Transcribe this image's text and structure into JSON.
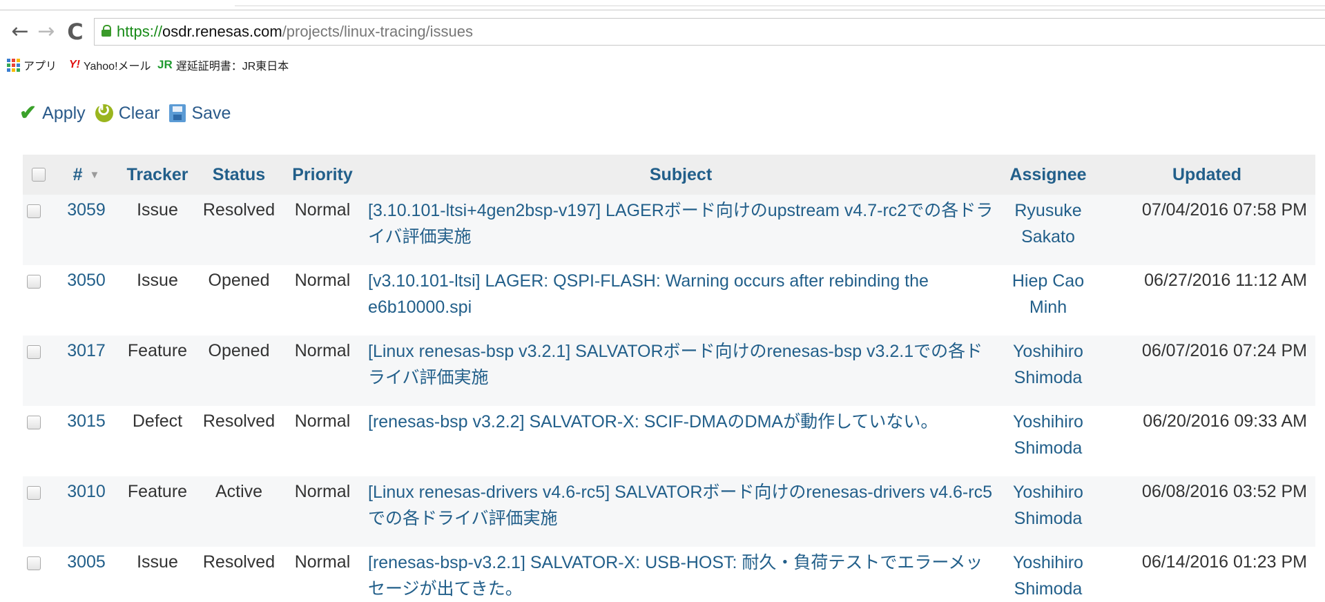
{
  "browser": {
    "url_scheme": "https://",
    "url_host": "osdr.renesas.com",
    "url_path": "/projects/linux-tracing/issues",
    "back_glyph": "←",
    "forward_glyph": "→",
    "reload_glyph": "C"
  },
  "bookmarks": [
    {
      "label": "アプリ"
    },
    {
      "logo": "Y!",
      "label": "Yahoo!メール"
    },
    {
      "logo": "JR",
      "label": "遅延証明書：JR東日本"
    }
  ],
  "actions": {
    "apply_label": "Apply",
    "clear_label": "Clear",
    "save_label": "Save"
  },
  "table": {
    "headers": {
      "id": "#",
      "tracker": "Tracker",
      "status": "Status",
      "priority": "Priority",
      "subject": "Subject",
      "assignee": "Assignee",
      "updated": "Updated"
    },
    "sort_glyph": "▼",
    "rows": [
      {
        "id": "3059",
        "tracker": "Issue",
        "status": "Resolved",
        "priority": "Normal",
        "subject": "[3.10.101-ltsi+4gen2bsp-v197] LAGERボード向けのupstream v4.7-rc2での各ドライバ評価実施",
        "assignee": "Ryusuke Sakato",
        "updated": "07/04/2016 07:58 PM"
      },
      {
        "id": "3050",
        "tracker": "Issue",
        "status": "Opened",
        "priority": "Normal",
        "subject": "[v3.10.101-ltsi] LAGER: QSPI-FLASH: Warning occurs after rebinding the e6b10000.spi",
        "assignee": "Hiep Cao Minh",
        "updated": "06/27/2016 11:12 AM"
      },
      {
        "id": "3017",
        "tracker": "Feature",
        "status": "Opened",
        "priority": "Normal",
        "subject": "[Linux renesas-bsp v3.2.1] SALVATORボード向けのrenesas-bsp v3.2.1での各ドライバ評価実施",
        "assignee": "Yoshihiro Shimoda",
        "updated": "06/07/2016 07:24 PM"
      },
      {
        "id": "3015",
        "tracker": "Defect",
        "status": "Resolved",
        "priority": "Normal",
        "subject": "[renesas-bsp v3.2.2] SALVATOR-X: SCIF-DMAのDMAが動作していない。",
        "assignee": "Yoshihiro Shimoda",
        "updated": "06/20/2016 09:33 AM"
      },
      {
        "id": "3010",
        "tracker": "Feature",
        "status": "Active",
        "priority": "Normal",
        "subject": "[Linux renesas-drivers v4.6-rc5] SALVATORボード向けのrenesas-drivers v4.6-rc5での各ドライバ評価実施",
        "assignee": "Yoshihiro Shimoda",
        "updated": "06/08/2016 03:52 PM"
      },
      {
        "id": "3005",
        "tracker": "Issue",
        "status": "Resolved",
        "priority": "Normal",
        "subject": "[renesas-bsp-v3.2.1] SALVATOR-X: USB-HOST: 耐久・負荷テストでエラーメッセージが出てきた。",
        "assignee": "Yoshihiro Shimoda",
        "updated": "06/14/2016 01:23 PM"
      }
    ]
  }
}
